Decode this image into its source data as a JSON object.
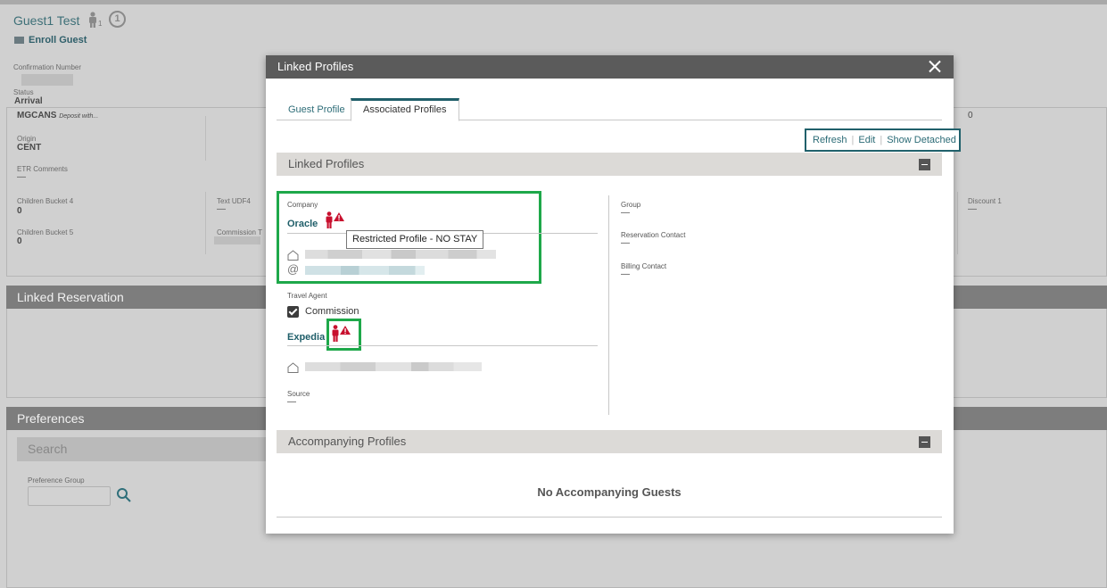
{
  "background": {
    "guest_name": "Guest1 Test",
    "guest_count": "1",
    "notification_count": "1",
    "enroll_label": "Enroll Guest",
    "confirmation_label": "Confirmation Number",
    "status_label": "Status",
    "status_value": "Arrival",
    "market_value": "MGCANS",
    "market_note": "Deposit with...",
    "origin_label": "Origin",
    "origin_value": "CENT",
    "etr_label": "ETR Comments",
    "etr_value": "—",
    "children4_label": "Children Bucket 4",
    "children4_value": "0",
    "udf4_label": "Text UDF4",
    "udf4_value": "—",
    "children5_label": "Children Bucket 5",
    "children5_value": "0",
    "commission_label": "Commission T",
    "right_zero": "0",
    "discount_label": "Discount 1",
    "discount_value": "—",
    "linked_reservation": "Linked Reservation",
    "preferences": "Preferences",
    "search_label": "Search",
    "pref_group_label": "Preference Group"
  },
  "modal": {
    "title": "Linked Profiles",
    "tabs": [
      {
        "label": "Guest Profile",
        "active": false
      },
      {
        "label": "Associated Profiles",
        "active": true
      }
    ],
    "actions": {
      "refresh": "Refresh",
      "edit": "Edit",
      "show_detached": "Show Detached"
    },
    "linked_section_title": "Linked Profiles",
    "company": {
      "label": "Company",
      "name": "Oracle",
      "tooltip": "Restricted Profile - NO STAY"
    },
    "travel_agent": {
      "label": "Travel Agent",
      "commission_label": "Commission",
      "commission_checked": true,
      "name": "Expedia"
    },
    "source": {
      "label": "Source",
      "value": "—"
    },
    "group": {
      "label": "Group",
      "value": "—"
    },
    "reservation_contact": {
      "label": "Reservation Contact",
      "value": "—"
    },
    "billing_contact": {
      "label": "Billing Contact",
      "value": "—"
    },
    "accompanying_title": "Accompanying Profiles",
    "no_accompanying": "No Accompanying Guests"
  },
  "colors": {
    "accent": "#1f5e69",
    "highlight_green": "#1ea84a",
    "restricted_red": "#c8102e",
    "header_gray": "#5b5b5b"
  },
  "icons": [
    "person-icon",
    "restricted-person-icon",
    "warning-icon",
    "house-icon",
    "at-icon",
    "close-icon",
    "collapse-icon",
    "search-icon",
    "id-card-icon"
  ]
}
